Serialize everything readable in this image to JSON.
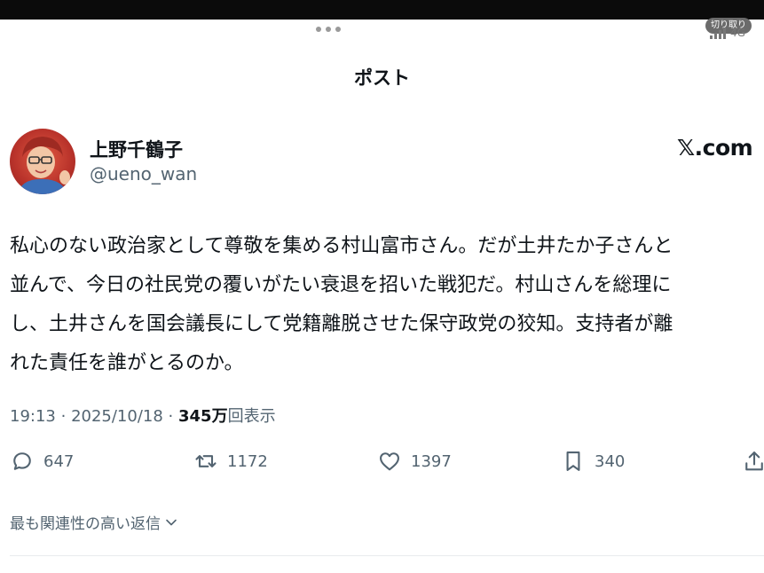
{
  "status_bar": {
    "crop_label": "切り取り",
    "network_label": "4G"
  },
  "header": {
    "title": "ポスト"
  },
  "author": {
    "display_name": "上野千鶴子",
    "handle": "@ueno_wan"
  },
  "brand": {
    "watermark": "𝕏.com"
  },
  "post": {
    "lines": [
      "私心のない政治家として尊敬を集める村山富市さん。だが土井たか子さんと",
      "並んで、今日の社民党の覆いがたい衰退を招いた戦犯だ。村山さんを総理に",
      "し、土井さんを国会議長にして党籍離脱させた保守政党の狡知。支持者が離",
      "れた責任を誰がとるのか。"
    ],
    "time": "19:13",
    "date": "2025/10/18",
    "views_count": "345万",
    "views_label": "回表示"
  },
  "actions": {
    "replies": "647",
    "reposts": "1172",
    "likes": "1397",
    "bookmarks": "340"
  },
  "replies_sort": {
    "label": "最も関連性の高い返信"
  },
  "icons": {
    "reply": "speech-bubble-icon",
    "repost": "repost-arrows-icon",
    "like": "heart-icon",
    "bookmark": "bookmark-icon",
    "share": "share-icon",
    "chevron": "chevron-down-icon",
    "signal": "signal-bars-icon"
  },
  "colors": {
    "text": "#0f1419",
    "secondary": "#536471",
    "avatar": "#c8382e"
  }
}
